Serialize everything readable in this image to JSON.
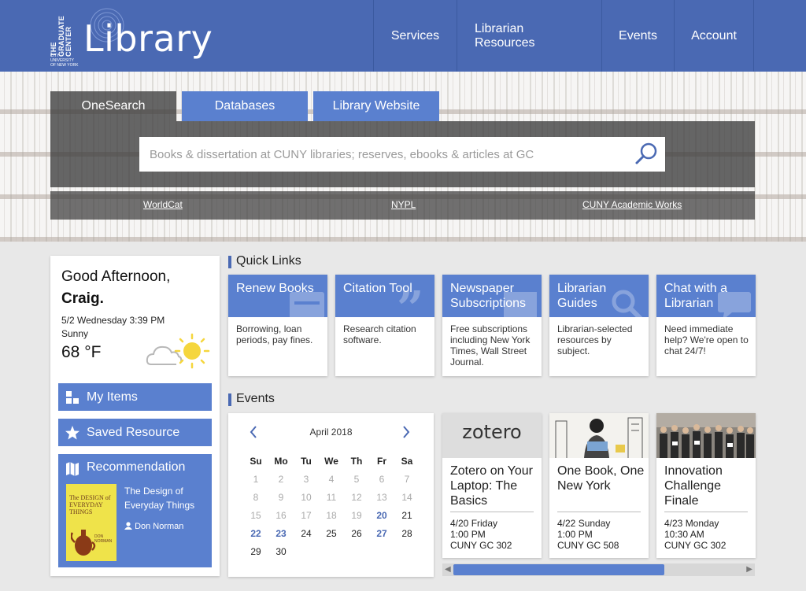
{
  "header": {
    "logo": {
      "line1": "THE",
      "line2": "GRADUATE",
      "line3": "CENTER",
      "cuny1": "CITY UNIVERSITY",
      "cuny2": "OF NEW YORK",
      "word": "Library"
    },
    "nav": [
      "Services",
      "Librarian Resources",
      "Events",
      "Account"
    ]
  },
  "search": {
    "tabs": [
      "OneSearch",
      "Databases",
      "Library Website"
    ],
    "placeholder": "Books & dissertation at CUNY libraries; reserves, ebooks & articles at GC",
    "alt_links": [
      "WorldCat",
      "NYPL",
      "CUNY Academic Works"
    ]
  },
  "welcome": {
    "greeting": "Good Afternoon,",
    "name": "Craig.",
    "datetime": "5/2 Wednesday 3:39 PM",
    "condition": "Sunny",
    "temperature": "68 °F",
    "buttons": [
      "My Items",
      "Saved Resource"
    ],
    "recommendation": {
      "label": "Recommendation",
      "cover_title": "The DESIGN of EVERYDAY THINGS",
      "cover_author": "DON NORMAN",
      "book": "The Design of Everyday Things",
      "author": "Don Norman"
    }
  },
  "quick_links": {
    "heading": "Quick Links",
    "items": [
      {
        "title": "Renew Books",
        "desc": "Borrowing, loan periods, pay fines.",
        "icon": "card-icon"
      },
      {
        "title": "Citation Tool",
        "desc": "Research citation software.",
        "icon": "quote-icon"
      },
      {
        "title": "Newspaper Subscriptions",
        "desc": "Free subscriptions including New York Times, Wall Street Journal.",
        "icon": "newspaper-icon"
      },
      {
        "title": "Librarian Guides",
        "desc": "Librarian-selected resources by subject.",
        "icon": "magnifier-icon"
      },
      {
        "title": "Chat with a Librarian",
        "desc": "Need immediate help? We're open to chat 24/7!",
        "icon": "chat-icon"
      }
    ]
  },
  "events": {
    "heading": "Events",
    "calendar": {
      "month": "April 2018",
      "weekdays": [
        "Su",
        "Mo",
        "Tu",
        "We",
        "Th",
        "Fr",
        "Sa"
      ],
      "weeks": [
        [
          "1",
          "2",
          "3",
          "4",
          "5",
          "6",
          "7"
        ],
        [
          "8",
          "9",
          "10",
          "11",
          "12",
          "13",
          "14"
        ],
        [
          "15",
          "16",
          "17",
          "18",
          "19",
          "20",
          "21"
        ],
        [
          "22",
          "23",
          "24",
          "25",
          "26",
          "27",
          "28"
        ],
        [
          "29",
          "30",
          "",
          "",
          "",
          "",
          ""
        ]
      ]
    },
    "items": [
      {
        "image_text": "zotero",
        "title": "Zotero on Your Laptop: The Basics",
        "date": "4/20 Friday",
        "time": "1:00 PM",
        "place": "CUNY GC 302"
      },
      {
        "image_text": "",
        "title": "One Book, One New York",
        "date": "4/22 Sunday",
        "time": "1:00 PM",
        "place": "CUNY GC 508"
      },
      {
        "image_text": "",
        "title": "Innovation Challenge Finale",
        "date": "4/23 Monday",
        "time": "10:30 AM",
        "place": "CUNY GC 302"
      }
    ]
  },
  "colors": {
    "brand": "#4a69b3",
    "accent": "#5a80cf",
    "background": "#e8e8e8"
  }
}
